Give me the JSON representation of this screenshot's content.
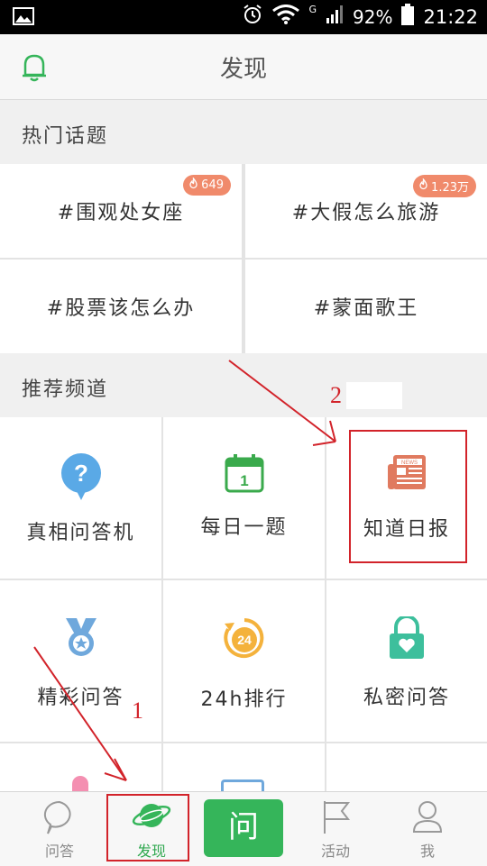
{
  "status_bar": {
    "network": "G",
    "battery": "92%",
    "time": "21:22"
  },
  "header": {
    "title": "发现"
  },
  "hot_topics": {
    "title": "热门话题",
    "items": [
      {
        "label": "#围观处女座",
        "badge": "649"
      },
      {
        "label": "#大假怎么旅游",
        "badge": "1.23万"
      },
      {
        "label": "#股票该怎么办"
      },
      {
        "label": "#蒙面歌王"
      }
    ]
  },
  "channels": {
    "title": "推荐频道",
    "items": [
      {
        "label": "真相问答机",
        "icon": "question-bubble-icon"
      },
      {
        "label": "每日一题",
        "icon": "calendar-icon"
      },
      {
        "label": "知道日报",
        "icon": "newspaper-icon"
      },
      {
        "label": "精彩问答",
        "icon": "medal-icon"
      },
      {
        "label": "24h排行",
        "icon": "clock-24h-icon"
      },
      {
        "label": "私密问答",
        "icon": "lock-heart-icon"
      }
    ]
  },
  "bottom_nav": {
    "items": [
      {
        "label": "问答",
        "icon": "chat-bubble-icon"
      },
      {
        "label": "发现",
        "icon": "planet-icon",
        "active": true
      },
      {
        "label": "问",
        "icon": "ask-button"
      },
      {
        "label": "活动",
        "icon": "flag-icon"
      },
      {
        "label": "我",
        "icon": "user-icon"
      }
    ]
  },
  "annotations": {
    "step1": "1",
    "step2": "2"
  },
  "colors": {
    "accent_green": "#35b55a",
    "badge_orange": "#f08a6b",
    "annotation_red": "#d2232a"
  }
}
